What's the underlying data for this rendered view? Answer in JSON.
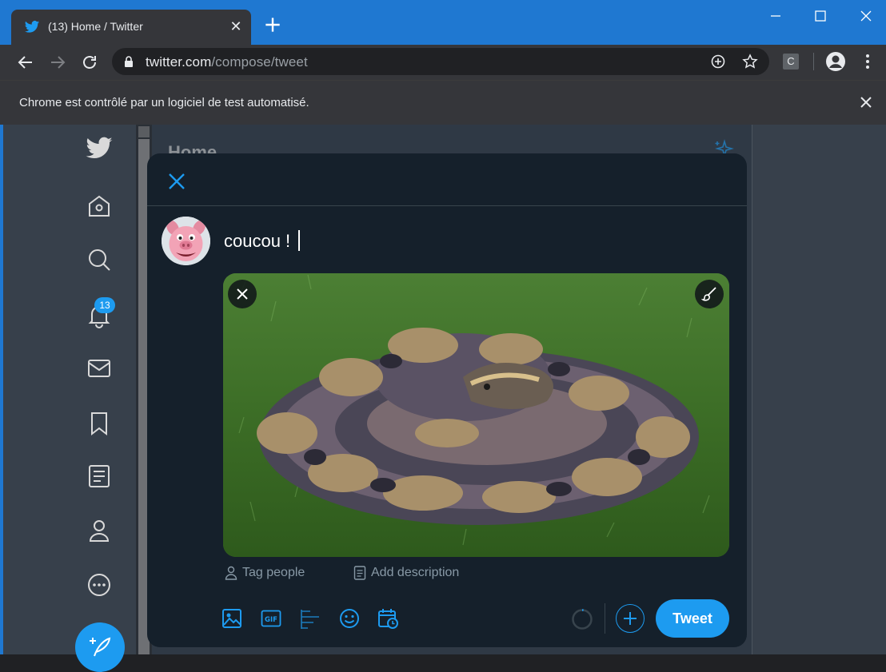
{
  "browser": {
    "tab_title": "(13) Home / Twitter",
    "url_host": "twitter.com",
    "url_path": "/compose/tweet",
    "infobar_text": "Chrome est contrôlé par un logiciel de test automatisé.",
    "profile_extension_letter": "C"
  },
  "sidebar": {
    "items": [
      {
        "name": "twitter-logo-icon"
      },
      {
        "name": "home-icon"
      },
      {
        "name": "explore-icon"
      },
      {
        "name": "notifications-icon",
        "badge": "13"
      },
      {
        "name": "messages-icon"
      },
      {
        "name": "bookmarks-icon"
      },
      {
        "name": "lists-icon"
      },
      {
        "name": "profile-icon"
      },
      {
        "name": "more-icon"
      }
    ]
  },
  "main": {
    "header": "Home"
  },
  "composer": {
    "text": "coucou !",
    "tag_people_label": "Tag people",
    "add_description_label": "Add description",
    "tweet_button_label": "Tweet"
  },
  "colors": {
    "accent": "#1d9bf0",
    "modal_bg": "#15202b",
    "page_bg": "#37404b"
  }
}
